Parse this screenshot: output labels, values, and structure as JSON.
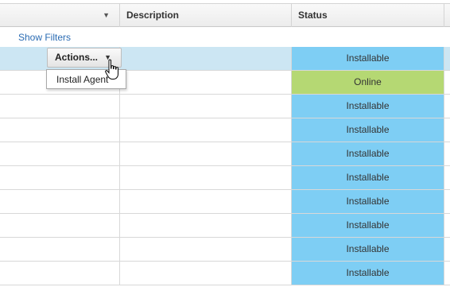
{
  "columns": {
    "first": {
      "sort_icon": "sort-caret-down-icon"
    },
    "description": "Description",
    "status": "Status"
  },
  "filters": {
    "show_filters_label": "Show Filters"
  },
  "actions": {
    "label": "Actions...",
    "caret_icon": "caret-down-icon",
    "menu_items": [
      {
        "label": "Install Agent"
      }
    ]
  },
  "rows": [
    {
      "status": "Installable",
      "status_kind": "installable",
      "selected": true
    },
    {
      "status": "Online",
      "status_kind": "online",
      "selected": false
    },
    {
      "status": "Installable",
      "status_kind": "installable",
      "selected": false
    },
    {
      "status": "Installable",
      "status_kind": "installable",
      "selected": false
    },
    {
      "status": "Installable",
      "status_kind": "installable",
      "selected": false
    },
    {
      "status": "Installable",
      "status_kind": "installable",
      "selected": false
    },
    {
      "status": "Installable",
      "status_kind": "installable",
      "selected": false
    },
    {
      "status": "Installable",
      "status_kind": "installable",
      "selected": false
    },
    {
      "status": "Installable",
      "status_kind": "installable",
      "selected": false
    },
    {
      "status": "Installable",
      "status_kind": "installable",
      "selected": false
    }
  ],
  "colors": {
    "installable": "#7ecef4",
    "online": "#b5d873",
    "selected_row": "#cce6f3",
    "link": "#2a6bb3"
  },
  "cursor_icon": "hand-pointer-icon"
}
